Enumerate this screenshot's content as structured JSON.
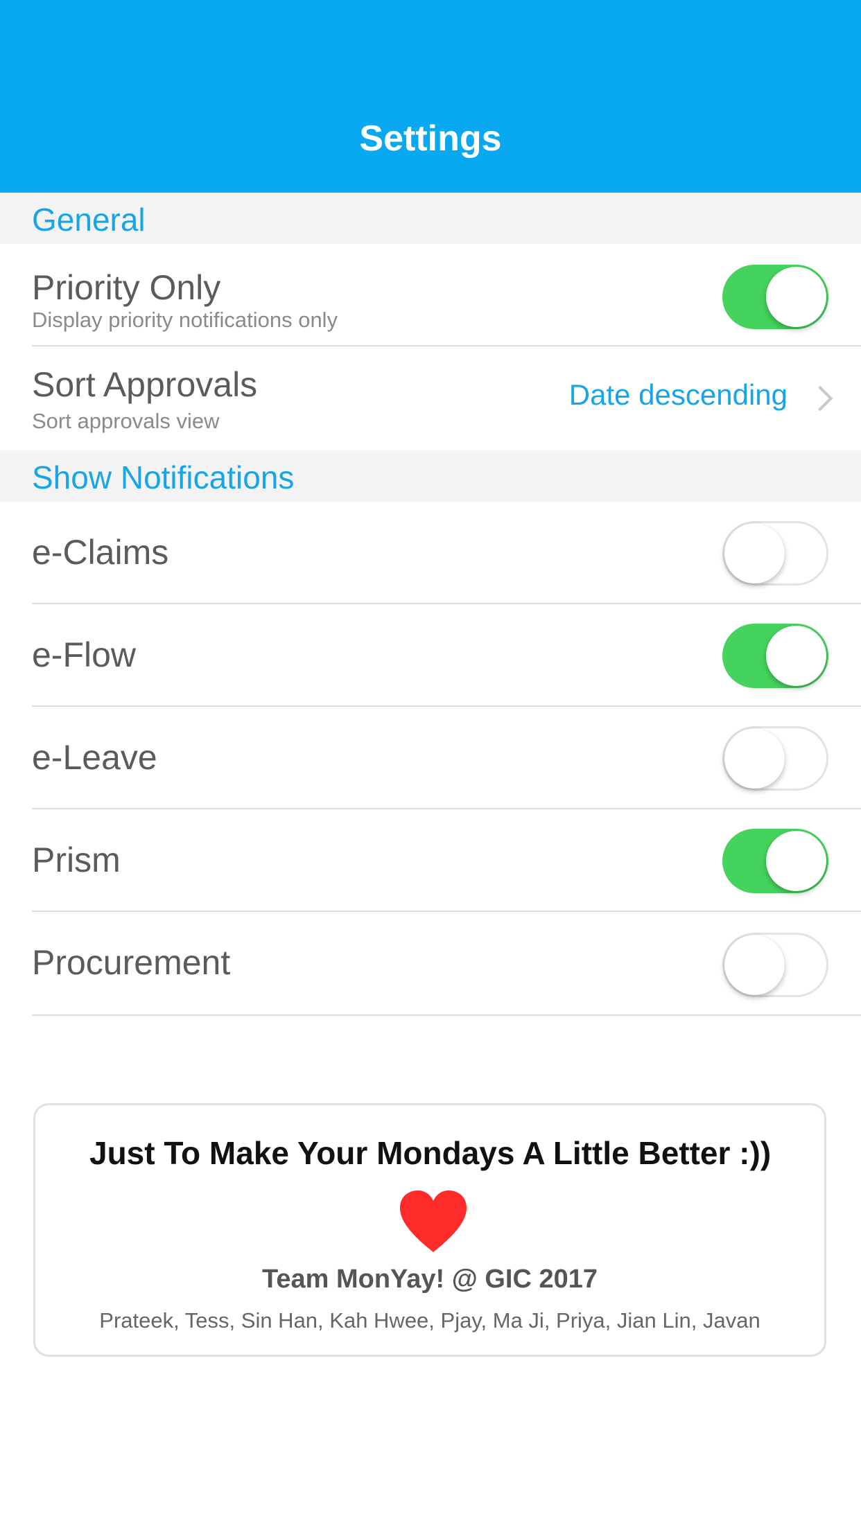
{
  "header": {
    "title": "Settings"
  },
  "sections": {
    "general": {
      "label": "General"
    },
    "notifications": {
      "label": "Show Notifications"
    }
  },
  "general": {
    "priority_only": {
      "label": "Priority Only",
      "subtitle": "Display priority notifications only",
      "enabled": true
    },
    "sort_approvals": {
      "label": "Sort Approvals",
      "subtitle": "Sort approvals view",
      "value": "Date descending"
    }
  },
  "notifications": [
    {
      "label": "e-Claims",
      "enabled": false
    },
    {
      "label": "e-Flow",
      "enabled": true
    },
    {
      "label": "e-Leave",
      "enabled": false
    },
    {
      "label": "Prism",
      "enabled": true
    },
    {
      "label": "Procurement",
      "enabled": false
    }
  ],
  "footer_card": {
    "title": "Just To Make Your Mondays A Little Better :))",
    "team": "Team MonYay! @ GIC 2017",
    "names": "Prateek, Tess, Sin Han, Kah Hwee, Pjay, Ma Ji, Priya, Jian Lin, Javan"
  },
  "colors": {
    "accent": "#08a9f1",
    "link": "#18a5e6",
    "toggle_on": "#44d35c",
    "heart": "#ff2a2a"
  },
  "icons": {
    "chevron": "chevron-right-icon",
    "heart": "heart-icon"
  }
}
